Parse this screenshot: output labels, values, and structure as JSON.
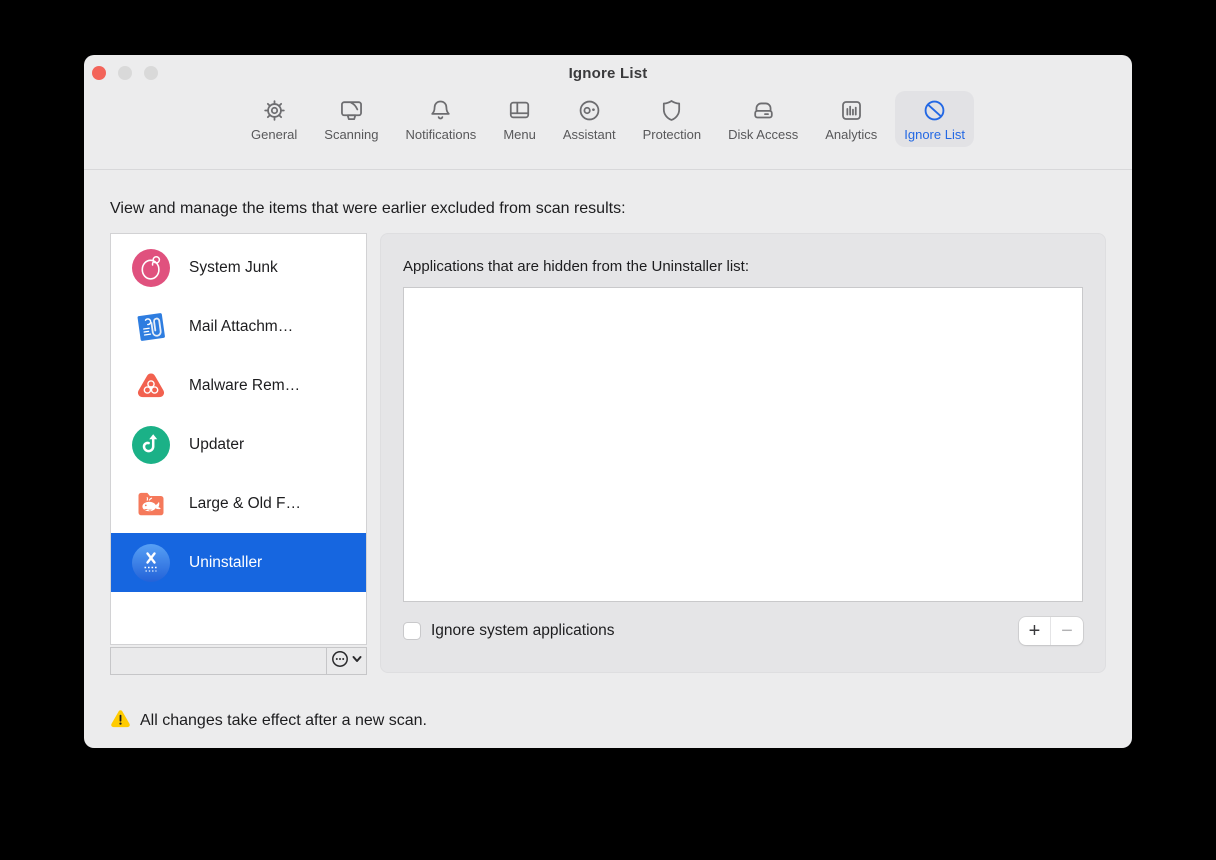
{
  "window": {
    "title": "Ignore List"
  },
  "traffic_lights": {
    "close_color": "#f3645a",
    "minimize_color": "#d9d9d9",
    "zoom_color": "#d9d9d9"
  },
  "toolbar": {
    "accent_color": "#2368e4",
    "selected": "Ignore List",
    "items": [
      {
        "label": "General",
        "icon": "gear-icon"
      },
      {
        "label": "Scanning",
        "icon": "display-icon"
      },
      {
        "label": "Notifications",
        "icon": "bell-icon"
      },
      {
        "label": "Menu",
        "icon": "window-panes-icon"
      },
      {
        "label": "Assistant",
        "icon": "face-icon"
      },
      {
        "label": "Protection",
        "icon": "shield-icon"
      },
      {
        "label": "Disk Access",
        "icon": "drive-icon"
      },
      {
        "label": "Analytics",
        "icon": "bar-chart-icon"
      },
      {
        "label": "Ignore List",
        "icon": "prohibition-icon"
      }
    ]
  },
  "content": {
    "instruction": "View and manage the items that were earlier excluded from scan results:"
  },
  "sidebar": {
    "selection_color": "#1666e0",
    "selected": "Uninstaller",
    "items": [
      {
        "label": "System Junk",
        "icon": "system-junk-icon",
        "color": "#e0517e"
      },
      {
        "label": "Mail Attachm…",
        "icon": "mail-attachments-icon",
        "color": "#2e7de0"
      },
      {
        "label": "Malware Rem…",
        "icon": "malware-removal-icon",
        "color": "#f2614f"
      },
      {
        "label": "Updater",
        "icon": "updater-icon",
        "color": "#1bb187"
      },
      {
        "label": "Large & Old F…",
        "icon": "large-old-files-icon",
        "color": "#f5795b"
      },
      {
        "label": "Uninstaller",
        "icon": "uninstaller-icon",
        "color": "#2e78e8"
      }
    ],
    "filter_input": {
      "value": "",
      "placeholder": ""
    }
  },
  "panel": {
    "header": "Applications that are hidden from the Uninstaller list:",
    "applications": [],
    "checkbox": {
      "label": "Ignore system applications",
      "checked": false
    },
    "add_label": "+",
    "remove_label": "−"
  },
  "footer": {
    "warning": "All changes take effect after a new scan."
  }
}
